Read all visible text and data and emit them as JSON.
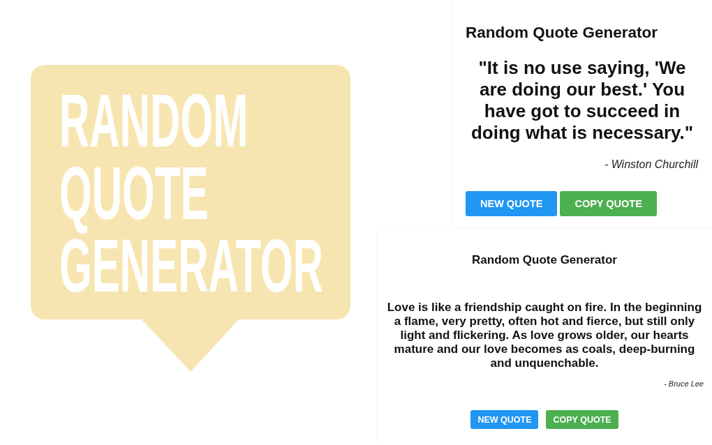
{
  "logo": {
    "text": "RANDOM QUOTE GENERATOR"
  },
  "previews": [
    {
      "kind": "large",
      "title": "Random Quote Generator",
      "quote": "\"It is no use saying, 'We are doing our best.' You have got to succeed in doing what is necessary.\"",
      "author": "- Winston Churchill",
      "buttons": [
        {
          "kind": "new",
          "label": "NEW QUOTE"
        },
        {
          "kind": "copy",
          "label": "COPY QUOTE"
        }
      ]
    },
    {
      "kind": "small",
      "title": "Random Quote Generator",
      "quote": "Love is like a friendship caught on fire. In the beginning a flame, very pretty, often hot and fierce, but still only light and flickering. As love grows older, our hearts mature and our love becomes as coals, deep-burning and unquenchable.",
      "author": "- Bruce Lee",
      "buttons": [
        {
          "kind": "new",
          "label": "NEW QUOTE"
        },
        {
          "kind": "copy",
          "label": "COPY QUOTE"
        }
      ]
    }
  ]
}
